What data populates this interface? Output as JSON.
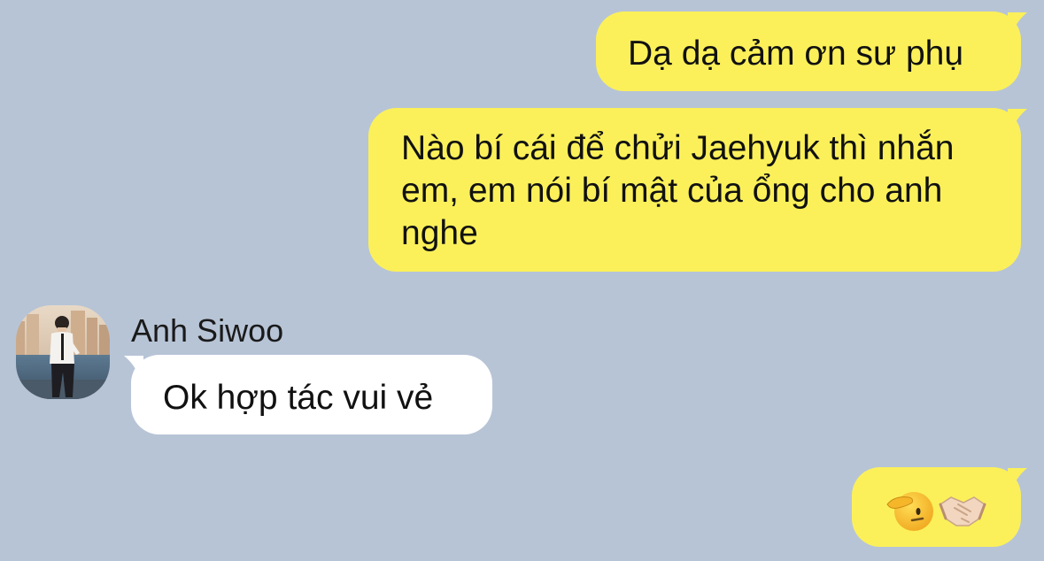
{
  "chat": {
    "messages": [
      {
        "direction": "outgoing",
        "text": "Dạ dạ cảm ơn sư phụ"
      },
      {
        "direction": "outgoing",
        "text": "Nào bí cái để chửi Jaehyuk thì nhắn em, em nói bí mật của ổng cho anh nghe"
      },
      {
        "direction": "incoming",
        "sender": "Anh Siwoo",
        "text": "Ok hợp tác vui vẻ"
      },
      {
        "direction": "outgoing",
        "emojis": [
          "saluting-face",
          "handshake"
        ]
      }
    ]
  },
  "theme": {
    "background": "#b7c4d6",
    "outgoing_bubble": "#fbf05a",
    "incoming_bubble": "#ffffff"
  }
}
